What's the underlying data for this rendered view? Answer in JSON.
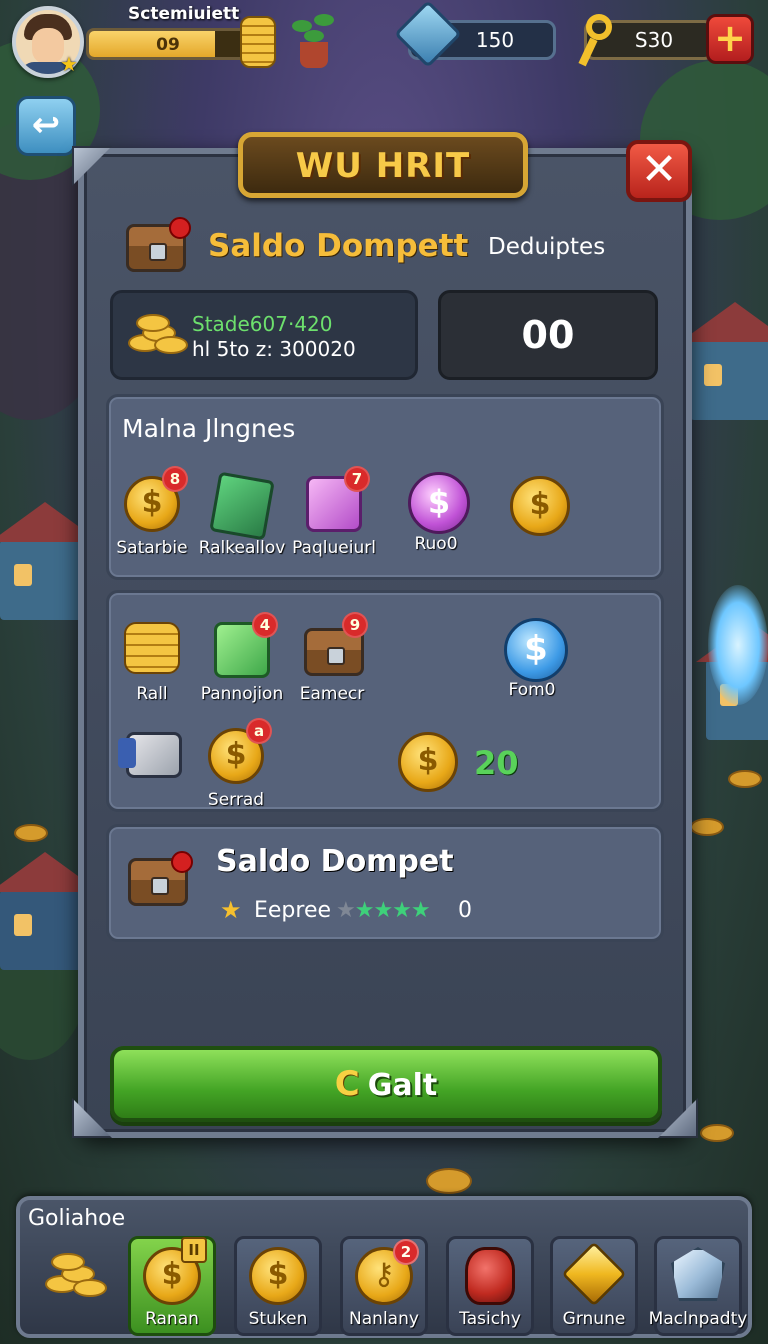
{
  "player": {
    "name": "Sctemiuiett",
    "level": "09",
    "xp_fraction": 0.8
  },
  "currencies": {
    "gems": "150",
    "gold": "S30",
    "add_label": "+"
  },
  "panel": {
    "title": "WU HRIT",
    "close_label": "✕",
    "wallet": {
      "title": "Saldo Dompett",
      "deposit": "Deduiptes",
      "balance_line1": "Stade607·420",
      "balance_line2": "hl 5to z: 300020",
      "count": "00"
    },
    "section1": {
      "title": "Malna Jlngnes",
      "items": [
        {
          "label": "Satarbie",
          "icon": "gold-coin-icon",
          "badge": "8"
        },
        {
          "label": "Ralkeallov",
          "icon": "green-book-icon",
          "badge": ""
        },
        {
          "label": "Paqlueiurl",
          "icon": "purple-cube-icon",
          "badge": "7"
        },
        {
          "label": "Ruo0",
          "icon": "purple-coin-icon",
          "badge": ""
        },
        {
          "label": "",
          "icon": "gold-coin-icon",
          "badge": ""
        }
      ]
    },
    "section2": {
      "items": [
        {
          "label": "Rall",
          "icon": "coin-stack-icon",
          "badge": ""
        },
        {
          "label": "Pannojion",
          "icon": "green-gift-box-icon",
          "badge": "4"
        },
        {
          "label": "Eamecr",
          "icon": "treasure-chest-icon",
          "badge": "9"
        },
        {
          "label": "Fom0",
          "icon": "blue-coin-icon",
          "badge": ""
        },
        {
          "label": "",
          "icon": "camera-icon",
          "badge": ""
        },
        {
          "label": "Serrad",
          "icon": "gold-coin-icon",
          "badge": "a"
        }
      ],
      "reward_value": "20"
    },
    "wallet_summary": {
      "title": "Saldo Dompet",
      "xp_label": "Eepree",
      "stars_dim": "★",
      "stars_lit": "★★★★",
      "stars_value": "0"
    },
    "action_button": {
      "icon_glyph": "C",
      "label": "Galt"
    }
  },
  "dock": {
    "title": "Goliahoe",
    "tabs": [
      {
        "label": "",
        "icon": "coin-pile-icon"
      },
      {
        "label": "Ranan",
        "icon": "gold-coin-icon",
        "active": true,
        "badge": "II"
      },
      {
        "label": "Stuken",
        "icon": "gold-coin-icon"
      },
      {
        "label": "Nanlany",
        "icon": "key-coin-icon",
        "badge": "2"
      },
      {
        "label": "Tasichy",
        "icon": "red-vase-icon"
      },
      {
        "label": "Grnune",
        "icon": "gold-shard-icon"
      },
      {
        "label": "Maclnpadty",
        "icon": "crystal-icon"
      }
    ]
  },
  "colors": {
    "accent_gold": "#f6bd3a",
    "accent_green": "#43a425",
    "close_red": "#b8241c",
    "panel_bg": "#4a5467"
  },
  "glyphs": {
    "coin": "$",
    "back": "↩",
    "star": "★"
  }
}
